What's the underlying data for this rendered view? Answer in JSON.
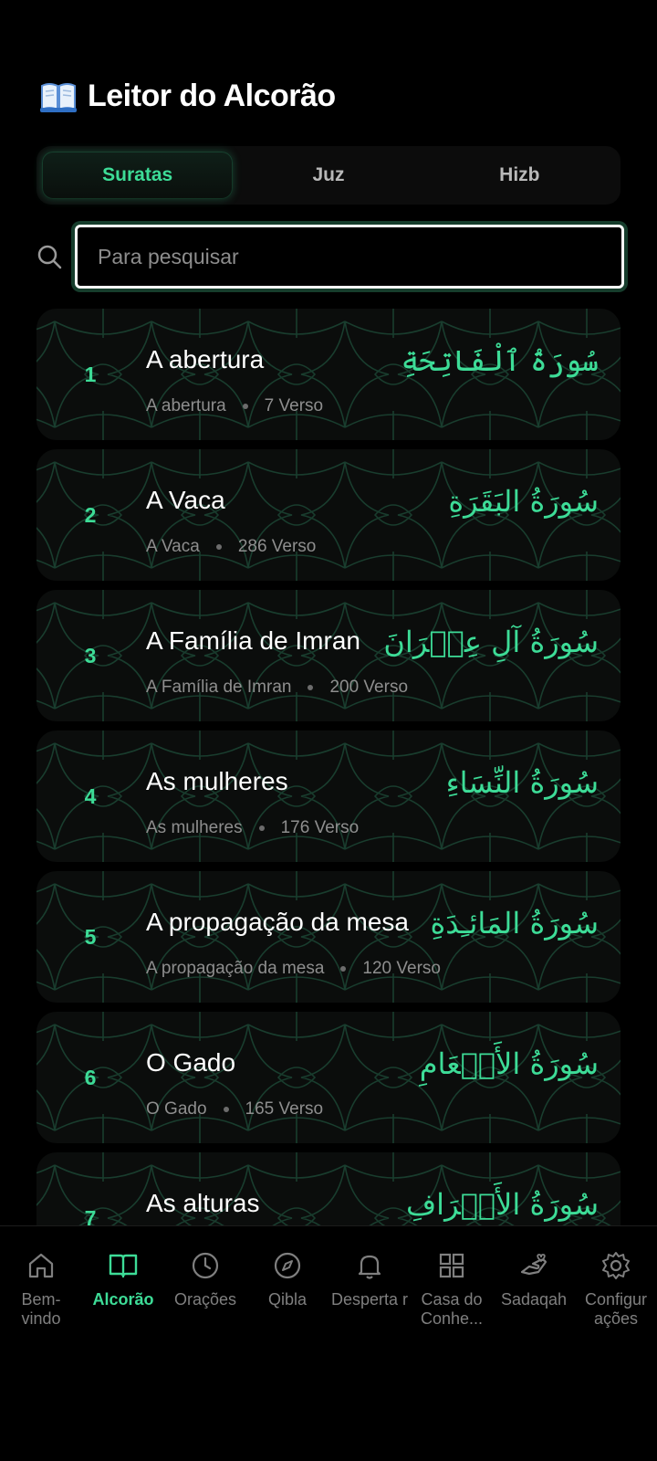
{
  "app": {
    "title": "Leitor do Alcorão",
    "icon": "open-book-icon"
  },
  "tabs": [
    {
      "label": "Suratas",
      "active": true
    },
    {
      "label": "Juz",
      "active": false
    },
    {
      "label": "Hizb",
      "active": false
    }
  ],
  "search": {
    "placeholder": "Para pesquisar",
    "value": ""
  },
  "surahs": [
    {
      "number": "1",
      "title": "A abertura",
      "subtitle": "A abertura",
      "verses": "7 Verso",
      "arabic": "سُورَةُ ٱلْفَاتِحَةِ"
    },
    {
      "number": "2",
      "title": "A Vaca",
      "subtitle": "A Vaca",
      "verses": "286 Verso",
      "arabic": "سُورَةُ البَقَرَةِ"
    },
    {
      "number": "3",
      "title": "A Família de Imran",
      "subtitle": "A Família de Imran",
      "verses": "200 Verso",
      "arabic": "سُورَةُ آلِ عِمۡرَانَ"
    },
    {
      "number": "4",
      "title": "As mulheres",
      "subtitle": "As mulheres",
      "verses": "176 Verso",
      "arabic": "سُورَةُ النِّسَاءِ"
    },
    {
      "number": "5",
      "title": "A propagação da mesa",
      "subtitle": "A propagação da mesa",
      "verses": "120 Verso",
      "arabic": "سُورَةُ المَائـِدَةِ"
    },
    {
      "number": "6",
      "title": "O Gado",
      "subtitle": "O Gado",
      "verses": "165 Verso",
      "arabic": "سُورَةُ الأَنۡعَامِ"
    },
    {
      "number": "7",
      "title": "As alturas",
      "subtitle": "",
      "verses": "",
      "arabic": "سُورَةُ الأَعۡرَافِ"
    }
  ],
  "nav": [
    {
      "label": "Bem-vindo",
      "icon": "home-icon",
      "active": false
    },
    {
      "label": "Alcorão",
      "icon": "book-icon",
      "active": true
    },
    {
      "label": "Orações",
      "icon": "clock-icon",
      "active": false
    },
    {
      "label": "Qibla",
      "icon": "compass-icon",
      "active": false
    },
    {
      "label": "Desperta r",
      "icon": "bell-icon",
      "active": false
    },
    {
      "label": "Casa do Conhe...",
      "icon": "grid-icon",
      "active": false
    },
    {
      "label": "Sadaqah",
      "icon": "charity-icon",
      "active": false
    },
    {
      "label": "Configur ações",
      "icon": "gear-icon",
      "active": false
    }
  ],
  "colors": {
    "accent": "#3ddc97",
    "background": "#000000",
    "card": "#0b0d0c",
    "pattern": "#1f4d3a",
    "muted": "#8e8e8e"
  }
}
